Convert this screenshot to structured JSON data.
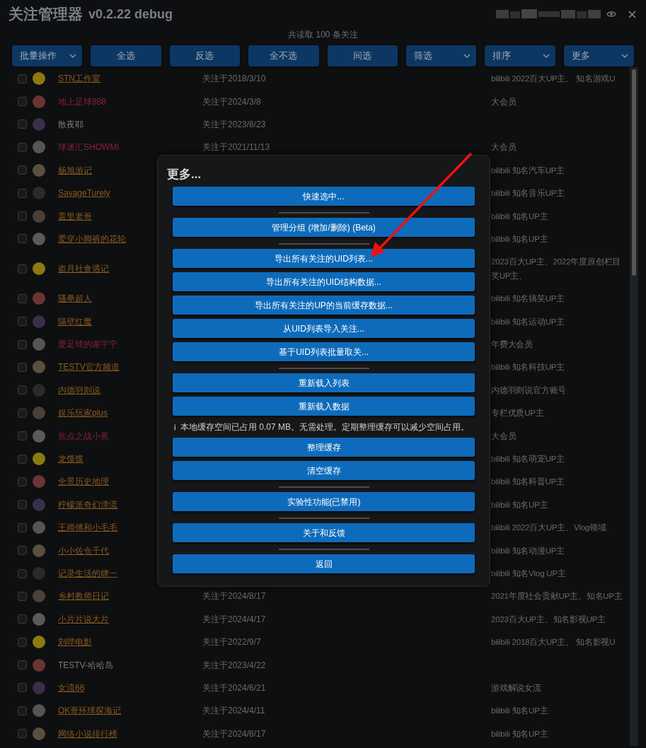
{
  "window": {
    "title": "关注管理器",
    "version": "v0.2.22 debug"
  },
  "summary": "共读取 100 条关注",
  "toolbar": [
    {
      "label": "批量操作",
      "dropdown": true
    },
    {
      "label": "全选",
      "dropdown": false
    },
    {
      "label": "反选",
      "dropdown": false
    },
    {
      "label": "全不选",
      "dropdown": false
    },
    {
      "label": "间选",
      "dropdown": false
    },
    {
      "label": "筛选",
      "dropdown": true
    },
    {
      "label": "排序",
      "dropdown": true
    },
    {
      "label": "更多",
      "dropdown": true
    }
  ],
  "rows": [
    {
      "name": "STN工作室",
      "kind": "link",
      "date": "关注于2018/3/10",
      "desc": "bilibili 2022百大UP主、 知名游戏U",
      "checked": false
    },
    {
      "name": "地上足球888",
      "kind": "vip",
      "date": "关注于2024/3/8",
      "desc": "大会员",
      "checked": false
    },
    {
      "name": "散夜耶",
      "kind": "plain",
      "date": "关注于2023/8/23",
      "checked": false
    },
    {
      "name": "球迷汇SHOWMI",
      "kind": "vip",
      "date": "关注于2021/11/13",
      "desc": "大会员",
      "checked": false
    },
    {
      "name": "杨旭游记",
      "kind": "link",
      "desc": "bilibili 知名汽车UP主",
      "checked": false
    },
    {
      "name": "SavageTurely",
      "kind": "link",
      "desc": "bilibili 知名音乐UP主",
      "checked": false
    },
    {
      "name": "盖里老哥",
      "kind": "link",
      "desc": "bilibili 知名UP主",
      "checked": false
    },
    {
      "name": "爱穿小脚裤的花轮",
      "kind": "link",
      "desc": "bilibili 知名UP主",
      "checked": false
    },
    {
      "name": "盗月社食遇记",
      "kind": "link",
      "desc": "2023百大UP主、2022年度原创栏目奖UP主、",
      "checked": false
    },
    {
      "name": "骚拳超人",
      "kind": "link",
      "desc": "bilibili 知名搞笑UP主",
      "checked": false
    },
    {
      "name": "隔壁红魔",
      "kind": "link",
      "desc": "bilibili 知名运动UP主",
      "checked": false
    },
    {
      "name": "爱足球的谢宇宁",
      "kind": "vip",
      "desc": "年费大会员",
      "checked": false
    },
    {
      "name": "TESTV官方频道",
      "kind": "link",
      "desc": "bilibili 知名科技UP主",
      "checked": false
    },
    {
      "name": "内德羽则说",
      "kind": "link",
      "desc": "内德羽则说官方账号",
      "checked": false
    },
    {
      "name": "娱乐玩家plus",
      "kind": "link",
      "desc": "专栏优质UP主",
      "checked": false
    },
    {
      "name": "焦点之战小蕉",
      "kind": "vip",
      "desc": "大会员",
      "checked": false
    },
    {
      "name": "龙馍馍",
      "kind": "link",
      "desc": "bilibili 知名萌宠UP主",
      "checked": false
    },
    {
      "name": "全景历史地理",
      "kind": "link",
      "desc": "bilibili 知名科普UP主",
      "checked": false
    },
    {
      "name": "柠檬派奇幻漂流",
      "kind": "link",
      "desc": "bilibili 知名UP主",
      "checked": false
    },
    {
      "name": "王师傅和小毛毛",
      "kind": "link",
      "desc": "bilibili 2022百大UP主、Vlog领域",
      "checked": false
    },
    {
      "name": "小小佐仓千代",
      "kind": "link",
      "desc": "bilibili 知名动漫UP主",
      "checked": false
    },
    {
      "name": "记录生活的肆一",
      "kind": "link",
      "desc": "bilibili 知名Vlog UP主",
      "checked": false
    },
    {
      "name": "乡村教师日记",
      "kind": "link",
      "date": "关注于2024/8/17",
      "desc": "2021年度社会贡献UP主、知名UP主",
      "checked": false
    },
    {
      "name": "小片片说大片",
      "kind": "link",
      "date": "关注于2024/4/17",
      "desc": "2023百大UP主、知名影视UP主",
      "checked": false
    },
    {
      "name": "刘哔电影",
      "kind": "link",
      "date": "关注于2022/9/7",
      "desc": "bilibili 2018百大UP主、 知名影视U",
      "checked": false
    },
    {
      "name": "TESTV-哈哈岛",
      "kind": "plain",
      "date": "关注于2023/4/22",
      "checked": false
    },
    {
      "name": "女流66",
      "kind": "link",
      "date": "关注于2024/6/21",
      "desc": "游戏解说女流",
      "checked": false
    },
    {
      "name": "OK哥环球探海记",
      "kind": "link",
      "date": "关注于2024/4/11",
      "desc": "bilibili 知名UP主",
      "checked": false
    },
    {
      "name": "网络小说排行榜",
      "kind": "link",
      "date": "关注于2024/8/17",
      "desc": "bilibili 知名UP主",
      "checked": false
    }
  ],
  "dialog": {
    "title": "更多...",
    "items": [
      {
        "kind": "button",
        "label": "快速选中..."
      },
      {
        "kind": "separator"
      },
      {
        "kind": "button",
        "label": "管理分组 (增加/删除) (Beta)"
      },
      {
        "kind": "separator"
      },
      {
        "kind": "button",
        "label": "导出所有关注的UID列表..."
      },
      {
        "kind": "button",
        "label": "导出所有关注的UID结构数据..."
      },
      {
        "kind": "button",
        "label": "导出所有关注的UP的当前缓存数据..."
      },
      {
        "kind": "button",
        "label": "从UID列表导入关注..."
      },
      {
        "kind": "button",
        "label": "基于UID列表批量取关..."
      },
      {
        "kind": "separator"
      },
      {
        "kind": "button",
        "label": "重新载入列表"
      },
      {
        "kind": "button",
        "label": "重新载入数据"
      },
      {
        "kind": "note",
        "icon": "ℹ",
        "label": "本地缓存空间已占用 0.07 MB。无需处理。定期整理缓存可以减少空间占用。"
      },
      {
        "kind": "button",
        "label": "整理缓存"
      },
      {
        "kind": "button",
        "label": "清空缓存"
      },
      {
        "kind": "separator"
      },
      {
        "kind": "button",
        "label": "实验性功能(已禁用)"
      },
      {
        "kind": "separator"
      },
      {
        "kind": "button",
        "label": "关于和反馈"
      },
      {
        "kind": "separator"
      },
      {
        "kind": "button",
        "label": "返回"
      }
    ]
  }
}
